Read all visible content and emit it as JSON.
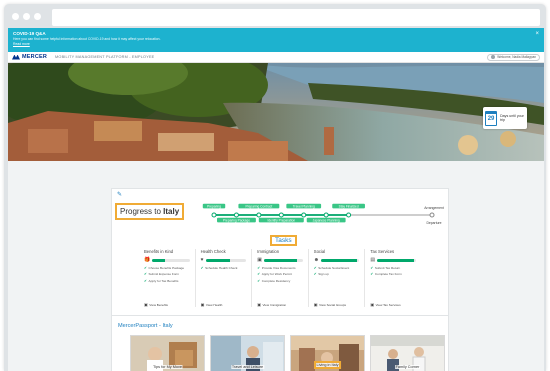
{
  "banner": {
    "title": "COVID-19 Q&A",
    "text": "Here you can find some helpful information about COVID-19 and how it may affect your relocation.",
    "link": "Read more",
    "close": "×"
  },
  "header": {
    "logo": "MERCER",
    "platform": "MOBILITY MANAGEMENT PLATFORM - EMPLOYEE",
    "user": "Welcome, Nadia Mallaypan"
  },
  "countdown": {
    "days": "29",
    "text": "Days until your trip"
  },
  "progress": {
    "title_prefix": "Progress to ",
    "destination": "Italy",
    "steps": [
      "Preparing",
      "Preparing Package",
      "Preparing Contract",
      "Identify Preparation",
      "Travel Planning",
      "Japanese Planning",
      "Stay Finalized"
    ],
    "right_top": "Arrangement",
    "right_bottom": "Departure",
    "completion": 0.63
  },
  "tasks": {
    "label": "Tasks",
    "columns": [
      {
        "title": "Benefits in Kind",
        "icon": "gift-icon",
        "progress": 0.35,
        "items": [
          "Choose Benefits Package",
          "Submit Expense Form",
          "Apply for Tax Benefits"
        ],
        "footer": "View Benefits"
      },
      {
        "title": "Health Check",
        "icon": "heart-icon",
        "progress": 0.6,
        "items": [
          "Schedule Health Check"
        ],
        "footer": "View Health"
      },
      {
        "title": "Immigration",
        "icon": "passport-icon",
        "progress": 0.85,
        "items": [
          "Provide Visa Documents",
          "Apply for Work Permit",
          "Complete Residency"
        ],
        "footer": "View Immigration"
      },
      {
        "title": "Social",
        "icon": "people-icon",
        "progress": 0.95,
        "items": [
          "Schedule Social Event",
          "Sign up"
        ],
        "footer": "View Social Groups"
      },
      {
        "title": "Tax Services",
        "icon": "document-icon",
        "progress": 0.95,
        "items": [
          "Submit Tax Return",
          "Complete Tax Form"
        ],
        "footer": "View Tax Services"
      }
    ]
  },
  "passport": {
    "title": "MercerPassport - Italy",
    "cards": [
      {
        "label": "Tips for My Move",
        "link": "Learn more"
      },
      {
        "label": "Travel and Leisure",
        "link": "Learn more"
      },
      {
        "label": "Living in Italy",
        "link": "Learn more"
      },
      {
        "label": "Family Corner",
        "link": "Learn more"
      }
    ]
  },
  "colors": {
    "banner": "#1db2cf",
    "accent": "#1d7fbf",
    "highlight": "#f0ab35",
    "success": "#00a86b"
  }
}
